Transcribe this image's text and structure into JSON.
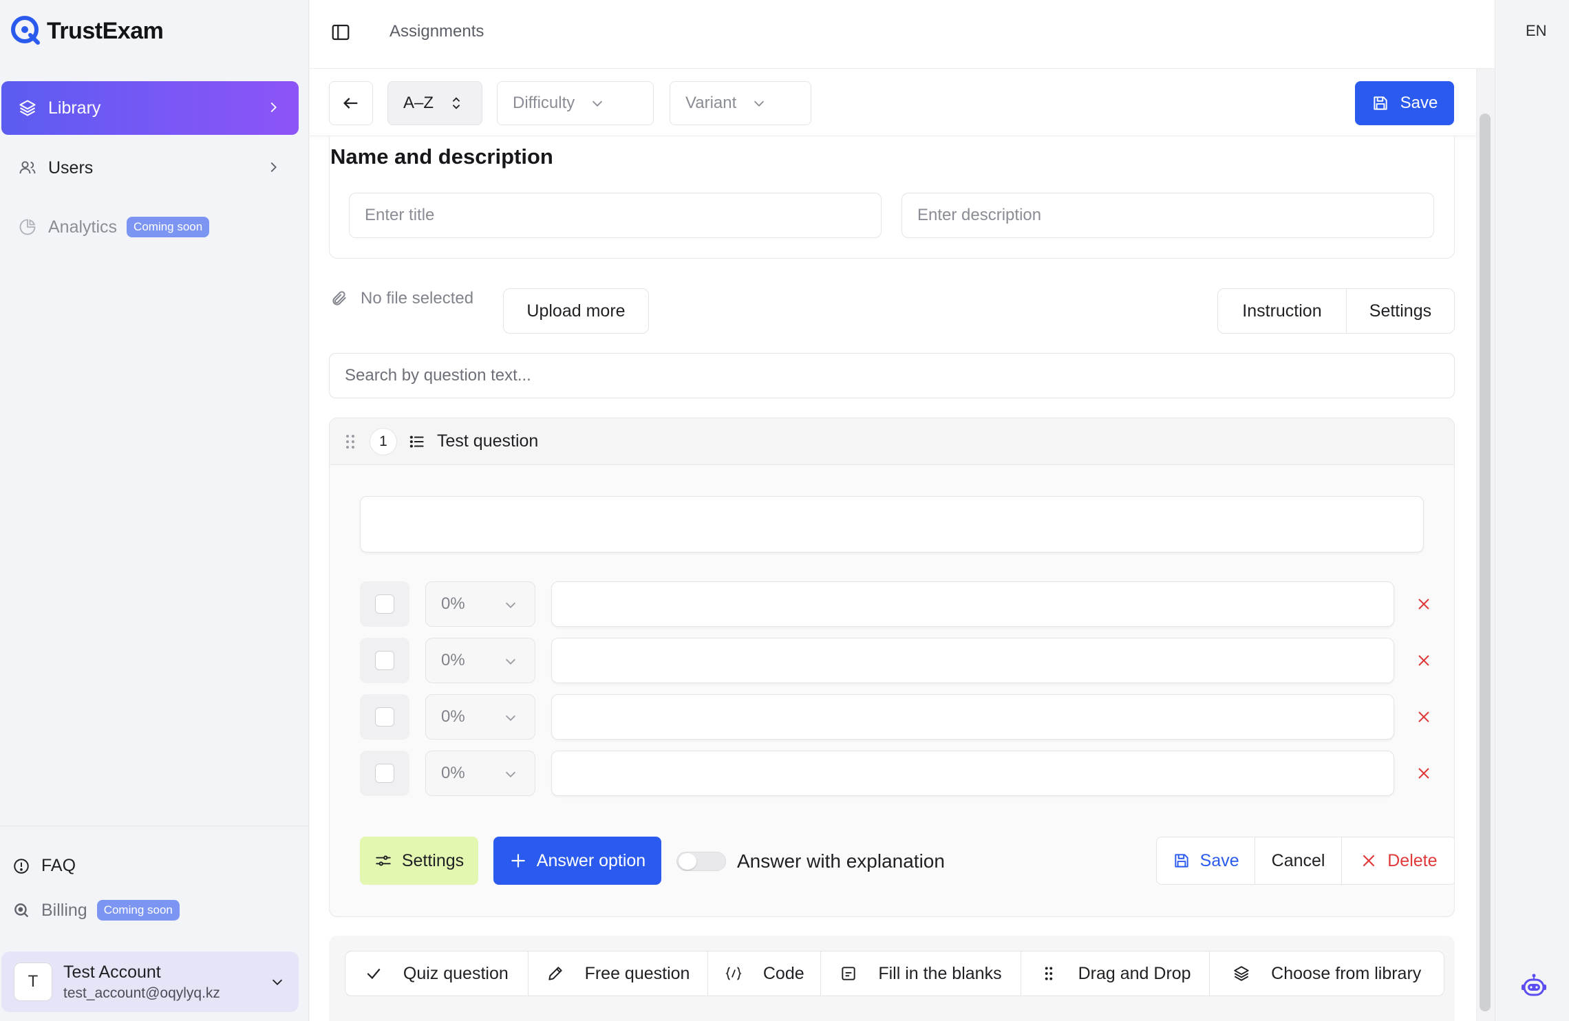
{
  "app": {
    "name": "TrustExam",
    "language": "EN",
    "accent": "#2b5bee",
    "brand_gradient": [
      "#5b5cf0",
      "#8d54f7"
    ]
  },
  "sidebar": {
    "items": [
      {
        "label": "Library",
        "icon": "layers-icon",
        "active": true
      },
      {
        "label": "Users",
        "icon": "users-icon"
      },
      {
        "label": "Analytics",
        "icon": "pie-chart-icon",
        "badge": "Coming soon"
      }
    ],
    "bottom": [
      {
        "label": "FAQ",
        "icon": "alert-circle-icon"
      },
      {
        "label": "Billing",
        "icon": "billing-icon",
        "badge": "Coming soon"
      }
    ],
    "account": {
      "initial": "T",
      "name": "Test Account",
      "email": "test_account@oqylyq.kz"
    }
  },
  "header": {
    "breadcrumb": "Assignments"
  },
  "toolbar": {
    "sort_label": "A–Z",
    "difficulty_label": "Difficulty",
    "variant_label": "Variant",
    "save_label": "Save"
  },
  "name_section": {
    "title": "Name and description",
    "title_placeholder": "Enter title",
    "description_placeholder": "Enter description"
  },
  "files": {
    "status": "No file selected",
    "upload_label": "Upload more",
    "instruction_label": "Instruction",
    "settings_label": "Settings"
  },
  "search": {
    "placeholder": "Search by question text..."
  },
  "question": {
    "number": "1",
    "title": "Test question",
    "answers": [
      {
        "percent": "0%",
        "checked": false
      },
      {
        "percent": "0%",
        "checked": false
      },
      {
        "percent": "0%",
        "checked": false
      },
      {
        "percent": "0%",
        "checked": false
      }
    ],
    "settings_label": "Settings",
    "add_answer_label": "Answer option",
    "explanation_label": "Answer with explanation",
    "explanation_enabled": false,
    "save_label": "Save",
    "cancel_label": "Cancel",
    "delete_label": "Delete"
  },
  "question_types": [
    {
      "label": "Quiz question",
      "icon": "check-icon"
    },
    {
      "label": "Free question",
      "icon": "pencil-icon"
    },
    {
      "label": "Code",
      "icon": "code-icon"
    },
    {
      "label": "Fill in the blanks",
      "icon": "blank-field-icon"
    },
    {
      "label": "Drag and Drop",
      "icon": "drag-dots-icon"
    },
    {
      "label": "Choose from library",
      "icon": "layers-icon"
    }
  ]
}
